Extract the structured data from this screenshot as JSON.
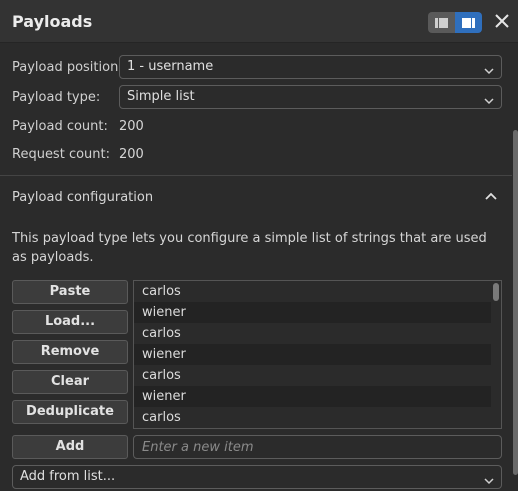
{
  "header": {
    "title": "Payloads"
  },
  "fields": {
    "position_label": "Payload position:",
    "position_value": "1 - username",
    "type_label": "Payload type:",
    "type_value": "Simple list",
    "count_label": "Payload count:",
    "count_value": "200",
    "request_label": "Request count:",
    "request_value": "200"
  },
  "config": {
    "title": "Payload configuration",
    "description": "This payload type lets you configure a simple list of strings that are used as payloads."
  },
  "buttons": {
    "paste": "Paste",
    "load": "Load...",
    "remove": "Remove",
    "clear": "Clear",
    "deduplicate": "Deduplicate",
    "add": "Add"
  },
  "list": {
    "items": [
      "carlos",
      "wiener",
      "carlos",
      "wiener",
      "carlos",
      "wiener",
      "carlos"
    ]
  },
  "add_input": {
    "placeholder": "Enter a new item"
  },
  "add_from_list": {
    "label": "Add from list..."
  },
  "colors": {
    "accent": "#2f6fbd",
    "background": "#2b2b2b"
  },
  "icons": [
    "list-view-icon",
    "detail-view-icon",
    "close-icon",
    "chevron-down-icon",
    "chevron-up-icon"
  ]
}
